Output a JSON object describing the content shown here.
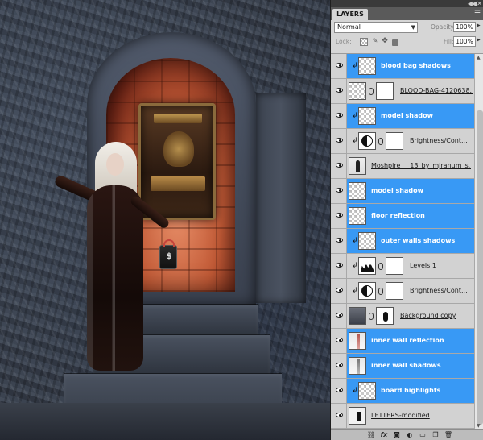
{
  "panel": {
    "tab_label": "LAYERS",
    "blend_mode": "Normal",
    "opacity_label": "Opacity:",
    "opacity_value": "100%",
    "lock_label": "Lock:",
    "fill_label": "Fill:",
    "fill_value": "100%"
  },
  "layers": [
    {
      "name": "blood bag shadows",
      "selected": true
    },
    {
      "name": "BLOOD-BAG-4120638....",
      "selected": false
    },
    {
      "name": "model shadow",
      "selected": true
    },
    {
      "name": "Brightness/Cont...",
      "selected": false
    },
    {
      "name": "Moshpire___13_by_mjranum_s...",
      "selected": false
    },
    {
      "name": "model shadow",
      "selected": true
    },
    {
      "name": "floor reflection",
      "selected": true
    },
    {
      "name": "outer walls shadows",
      "selected": true
    },
    {
      "name": "Levels 1",
      "selected": false
    },
    {
      "name": "Brightness/Cont...",
      "selected": false
    },
    {
      "name": "Background copy",
      "selected": false
    },
    {
      "name": "inner wall reflection",
      "selected": true
    },
    {
      "name": "inner wall shadows",
      "selected": true
    },
    {
      "name": "board highlights",
      "selected": true
    },
    {
      "name": "LETTERS-modified",
      "selected": false
    }
  ],
  "canvas": {
    "bag_symbol": "$"
  },
  "icons": {
    "collapse": "double-chevron-left-icon",
    "close": "close-icon",
    "panel_menu": "panel-menu-icon",
    "visibility": "eye-icon",
    "clipping": "clipping-arrow-icon",
    "link": "chain-link-icon",
    "footer": [
      "link-layers-icon",
      "fx-icon",
      "add-mask-icon",
      "adjustment-layer-icon",
      "new-group-icon",
      "new-layer-icon",
      "trash-icon"
    ]
  },
  "colors": {
    "selected_row": "#3899f5",
    "panel_bg": "#d6d6d6"
  }
}
